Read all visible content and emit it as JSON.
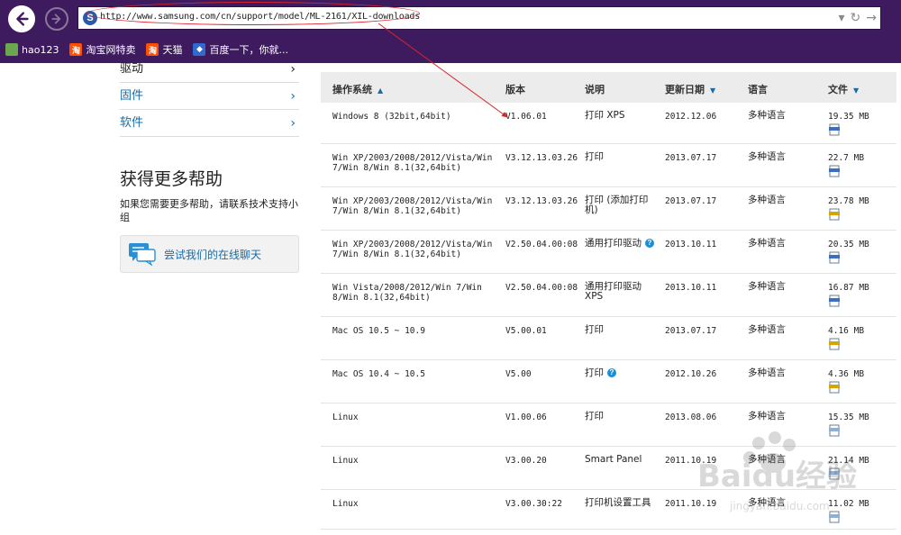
{
  "browser": {
    "url": "http://www.samsung.com/cn/support/model/ML-2161/XIL-downloads",
    "bookmarks": [
      {
        "label": "hao123",
        "icon": "hao123-icon",
        "color": "#6aa84f"
      },
      {
        "label": "淘宝网特卖",
        "icon": "taobao-icon",
        "color": "#ff5000"
      },
      {
        "label": "天猫",
        "icon": "tmall-icon",
        "color": "#ff5000"
      },
      {
        "label": "百度一下，你就...",
        "icon": "baidu-icon",
        "color": "#2e6ad1"
      }
    ]
  },
  "sidebar": {
    "links": [
      {
        "label": "驱动"
      },
      {
        "label": "固件"
      },
      {
        "label": "软件"
      }
    ],
    "help_title": "获得更多帮助",
    "help_desc": "如果您需要更多帮助，请联系技术支持小组",
    "chat_label": "尝试我们的在线聊天"
  },
  "table": {
    "headers": {
      "os": "操作系统",
      "version": "版本",
      "description": "说明",
      "date": "更新日期",
      "language": "语言",
      "file": "文件"
    },
    "rows": [
      {
        "os": "Windows 8 (32bit,64bit)",
        "version": "V1.06.01",
        "description": "打印 XPS",
        "date": "2012.12.06",
        "language": "多种语言",
        "size": "19.35 MB",
        "file_icon": "exe-file-icon",
        "help": false
      },
      {
        "os": "Win XP/2003/2008/2012/Vista/Win 7/Win 8/Win 8.1(32,64bit)",
        "version": "V3.12.13.03.26",
        "description": "打印",
        "date": "2013.07.17",
        "language": "多种语言",
        "size": "22.7 MB",
        "file_icon": "exe-file-icon",
        "help": false
      },
      {
        "os": "Win XP/2003/2008/2012/Vista/Win 7/Win 8/Win 8.1(32,64bit)",
        "version": "V3.12.13.03.26",
        "description": "打印 (添加打印机)",
        "date": "2013.07.17",
        "language": "多种语言",
        "size": "23.78 MB",
        "file_icon": "zip-file-icon",
        "help": false
      },
      {
        "os": "Win XP/2003/2008/2012/Vista/Win 7/Win 8/Win 8.1(32,64bit)",
        "version": "V2.50.04.00:08",
        "description": "通用打印驱动",
        "date": "2013.10.11",
        "language": "多种语言",
        "size": "20.35 MB",
        "file_icon": "exe-file-icon",
        "help": true
      },
      {
        "os": "Win Vista/2008/2012/Win 7/Win 8/Win 8.1(32,64bit)",
        "version": "V2.50.04.00:08",
        "description": "通用打印驱动 XPS",
        "date": "2013.10.11",
        "language": "多种语言",
        "size": "16.87 MB",
        "file_icon": "exe-file-icon",
        "help": false
      },
      {
        "os": "Mac OS 10.5 ~ 10.9",
        "version": "V5.00.01",
        "description": "打印",
        "date": "2013.07.17",
        "language": "多种语言",
        "size": "4.16 MB",
        "file_icon": "zip-file-icon",
        "help": false
      },
      {
        "os": "Mac OS 10.4 ~ 10.5",
        "version": "V5.00",
        "description": "打印",
        "date": "2012.10.26",
        "language": "多种语言",
        "size": "4.36 MB",
        "file_icon": "zip-file-icon",
        "help": true
      },
      {
        "os": "Linux",
        "version": "V1.00.06",
        "description": "打印",
        "date": "2013.08.06",
        "language": "多种语言",
        "size": "15.35 MB",
        "file_icon": "doc-file-icon",
        "help": false
      },
      {
        "os": "Linux",
        "version": "V3.00.20",
        "description": "Smart Panel",
        "date": "2011.10.19",
        "language": "多种语言",
        "size": "21.14 MB",
        "file_icon": "doc-file-icon",
        "help": false
      },
      {
        "os": "Linux",
        "version": "V3.00.30:22",
        "description": "打印机设置工具",
        "date": "2011.10.19",
        "language": "多种语言",
        "size": "11.02 MB",
        "file_icon": "doc-file-icon",
        "help": false
      }
    ]
  },
  "watermark": {
    "text": "Baidu经验",
    "sub": "jingyan.baidu.com"
  },
  "colors": {
    "chrome": "#3d1b5e",
    "link": "#1a6ca6",
    "annotation": "#d9252a",
    "header_bg": "#ececec"
  }
}
